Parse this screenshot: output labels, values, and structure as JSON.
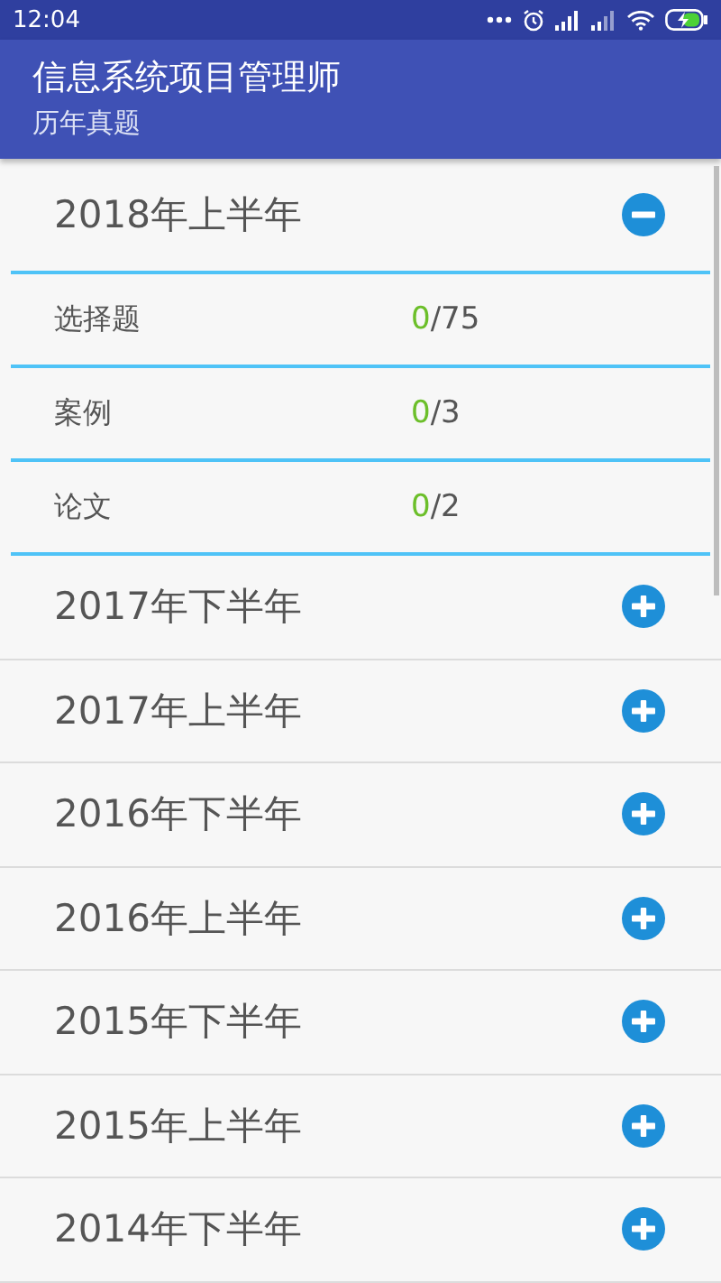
{
  "status_bar": {
    "time": "12:04"
  },
  "app_bar": {
    "title": "信息系统项目管理师",
    "subtitle": "历年真题"
  },
  "sections": [
    {
      "title": "2018年上半年",
      "expanded": true,
      "items": [
        {
          "label": "选择题",
          "done": "0",
          "rest": "/75"
        },
        {
          "label": "案例",
          "done": "0",
          "rest": "/3"
        },
        {
          "label": "论文",
          "done": "0",
          "rest": "/2"
        }
      ]
    },
    {
      "title": "2017年下半年",
      "expanded": false
    },
    {
      "title": "2017年上半年",
      "expanded": false
    },
    {
      "title": "2016年下半年",
      "expanded": false
    },
    {
      "title": "2016年上半年",
      "expanded": false
    },
    {
      "title": "2015年下半年",
      "expanded": false
    },
    {
      "title": "2015年上半年",
      "expanded": false
    },
    {
      "title": "2014年下半年",
      "expanded": false
    }
  ]
}
